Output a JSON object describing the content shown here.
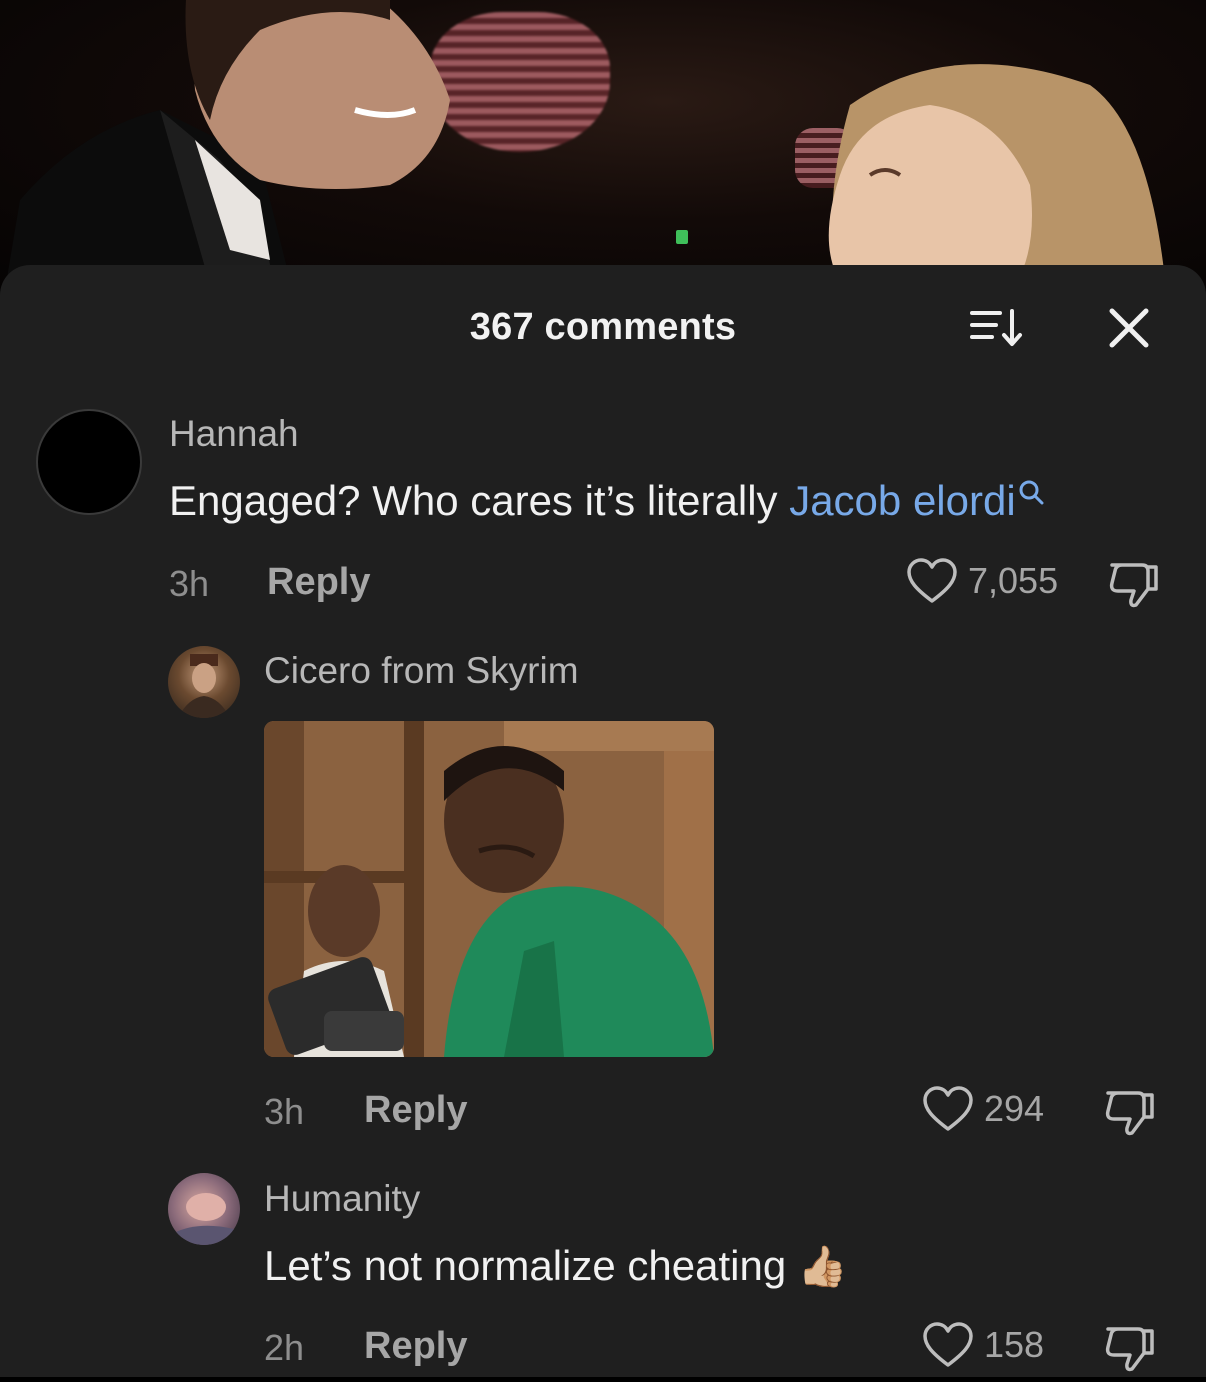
{
  "header": {
    "title": "367 comments"
  },
  "comments": [
    {
      "username": "Hannah",
      "text": "Engaged? Who cares it’s literally ",
      "mention": "Jacob elordi",
      "time": "3h",
      "reply_label": "Reply",
      "likes": "7,055"
    },
    {
      "username": "Cicero from Skyrim",
      "attachment": "reaction-gif",
      "time": "3h",
      "reply_label": "Reply",
      "likes": "294"
    },
    {
      "username": "Humanity",
      "text": "Let’s not normalize cheating",
      "emoji": "👍🏼",
      "time": "2h",
      "reply_label": "Reply",
      "likes": "158"
    }
  ],
  "icons": {
    "sort": "sort-icon",
    "close": "close-icon",
    "search": "search-icon",
    "like": "heart-icon",
    "dislike": "thumbs-down-icon"
  },
  "colors": {
    "sheet_bg": "#1f1f1f",
    "mention": "#78a9e8",
    "text_primary": "#f1f1f1",
    "text_secondary": "#a6a6a6"
  }
}
